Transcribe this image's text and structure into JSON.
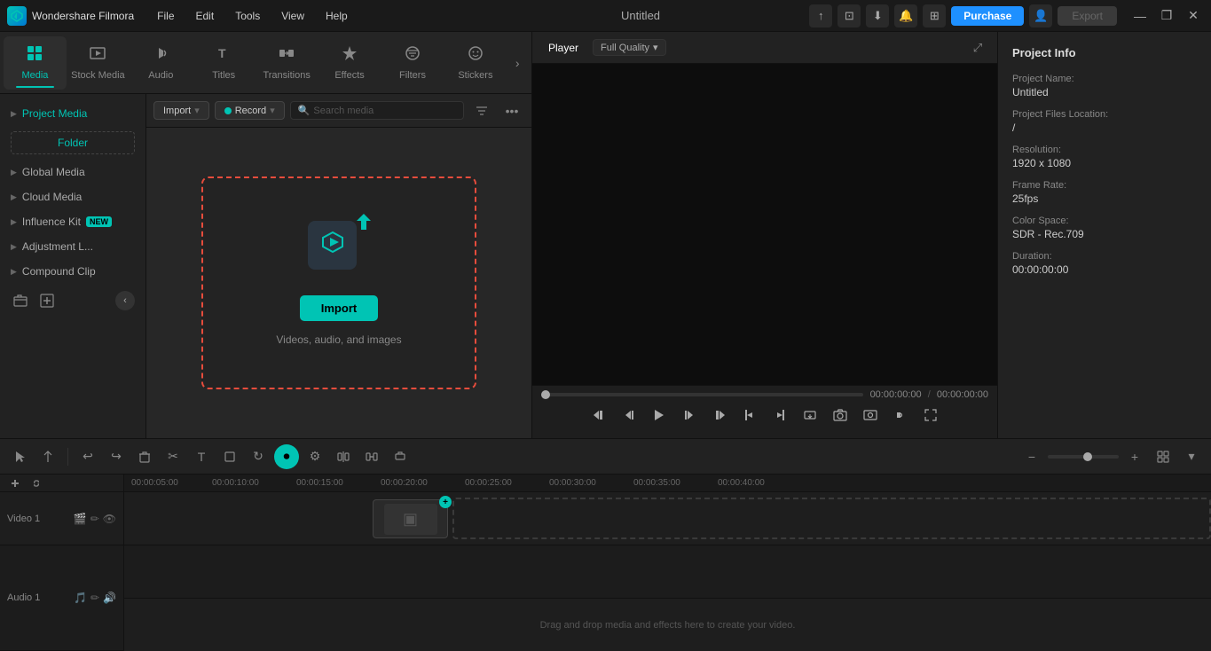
{
  "app": {
    "name": "Wondershare Filmora",
    "title": "Untitled"
  },
  "menubar": {
    "items": [
      "File",
      "Edit",
      "Tools",
      "View",
      "Help"
    ]
  },
  "titlebar": {
    "purchase_label": "Purchase",
    "export_label": "Export",
    "window_minimize": "—",
    "window_maximize": "❐",
    "window_close": "✕"
  },
  "tool_tabs": [
    {
      "id": "media",
      "label": "Media",
      "icon": "⊞",
      "active": true
    },
    {
      "id": "stock-media",
      "label": "Stock Media",
      "icon": "🎬"
    },
    {
      "id": "audio",
      "label": "Audio",
      "icon": "♪"
    },
    {
      "id": "titles",
      "label": "Titles",
      "icon": "T"
    },
    {
      "id": "transitions",
      "label": "Transitions",
      "icon": "↔"
    },
    {
      "id": "effects",
      "label": "Effects",
      "icon": "✦"
    },
    {
      "id": "filters",
      "label": "Filters",
      "icon": "⬡"
    },
    {
      "id": "stickers",
      "label": "Stickers",
      "icon": "★"
    }
  ],
  "sidebar": {
    "items": [
      {
        "id": "project-media",
        "label": "Project Media",
        "active": true
      },
      {
        "id": "global-media",
        "label": "Global Media"
      },
      {
        "id": "cloud-media",
        "label": "Cloud Media"
      },
      {
        "id": "influence-kit",
        "label": "Influence Kit",
        "badge": "NEW"
      },
      {
        "id": "adjustment-layer",
        "label": "Adjustment L..."
      },
      {
        "id": "compound-clip",
        "label": "Compound Clip"
      }
    ],
    "folder_label": "Folder"
  },
  "media_toolbar": {
    "import_label": "Import",
    "record_label": "Record",
    "search_placeholder": "Search media"
  },
  "drop_zone": {
    "import_btn_label": "Import",
    "hint_text": "Videos, audio, and images"
  },
  "player": {
    "tab_label": "Player",
    "quality_label": "Full Quality",
    "time_current": "00:00:00:00",
    "time_total": "00:00:00:00"
  },
  "project_info": {
    "title": "Project Info",
    "fields": [
      {
        "label": "Project Name:",
        "value": "Untitled"
      },
      {
        "label": "Project Files Location:",
        "value": "/"
      },
      {
        "label": "Resolution:",
        "value": "1920 x 1080"
      },
      {
        "label": "Frame Rate:",
        "value": "25fps"
      },
      {
        "label": "Color Space:",
        "value": "SDR - Rec.709"
      },
      {
        "label": "Duration:",
        "value": "00:00:00:00"
      }
    ]
  },
  "timeline": {
    "ruler_marks": [
      "00:00:05:00",
      "00:00:10:00",
      "00:00:15:00",
      "00:00:20:00",
      "00:00:25:00",
      "00:00:30:00",
      "00:00:35:00",
      "00:00:40:00"
    ],
    "tracks": [
      {
        "id": "video1",
        "label": "Video 1"
      },
      {
        "id": "audio1",
        "label": "Audio 1"
      }
    ],
    "drop_hint": "Drag and drop media and effects here to create your video."
  }
}
